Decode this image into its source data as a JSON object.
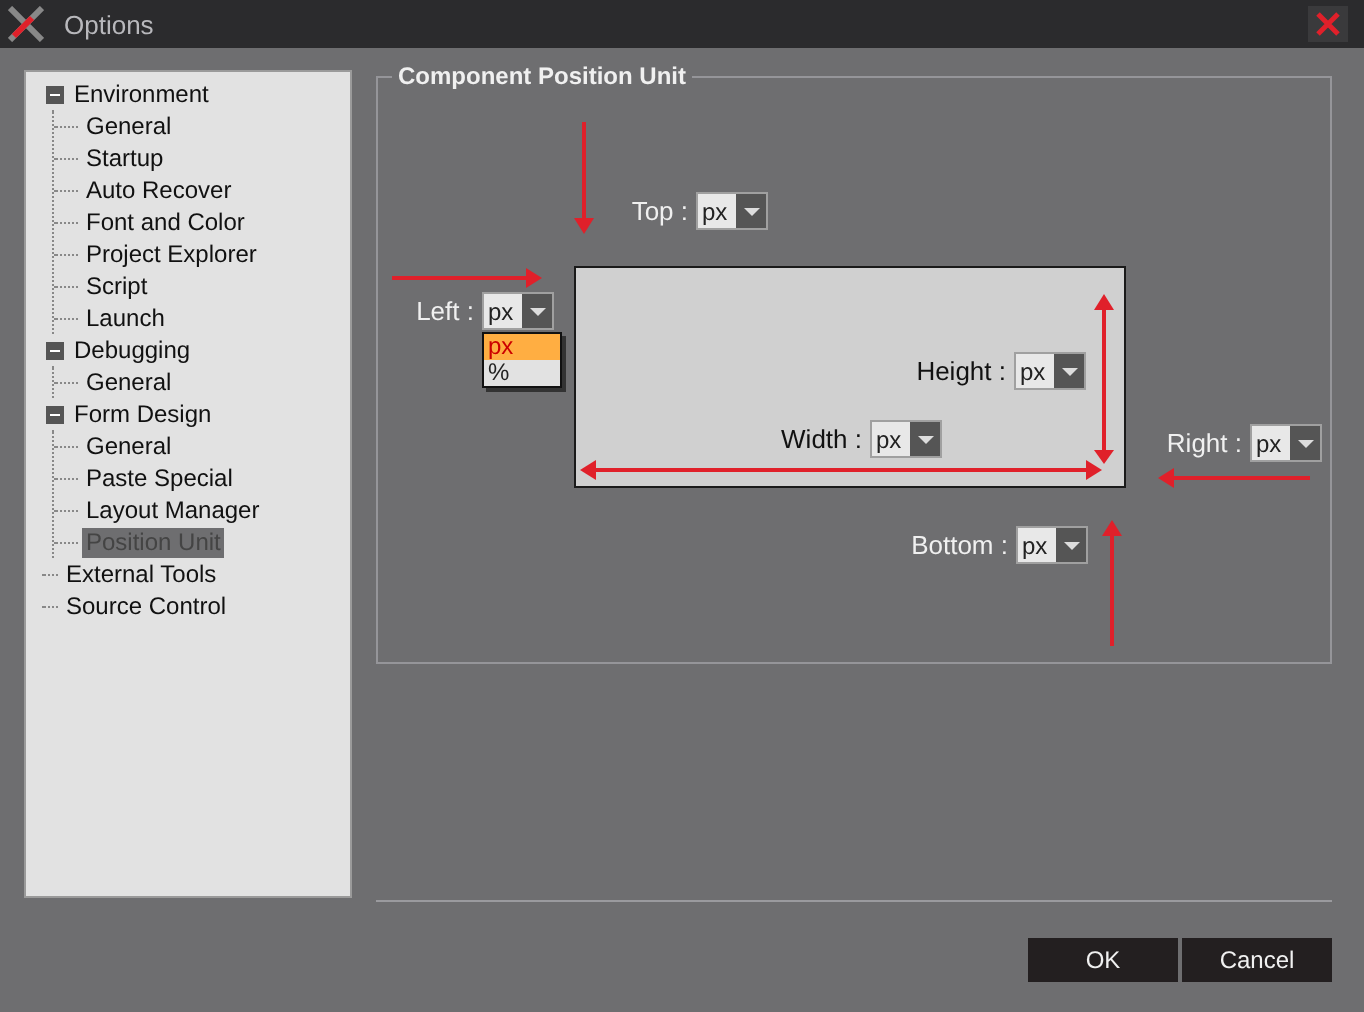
{
  "window": {
    "title": "Options"
  },
  "tree": [
    {
      "label": "Environment",
      "expanded": true,
      "selected": false,
      "children": [
        {
          "label": "General",
          "selected": false
        },
        {
          "label": "Startup",
          "selected": false
        },
        {
          "label": "Auto Recover",
          "selected": false
        },
        {
          "label": "Font and Color",
          "selected": false
        },
        {
          "label": "Project Explorer",
          "selected": false
        },
        {
          "label": "Script",
          "selected": false
        },
        {
          "label": "Launch",
          "selected": false
        }
      ]
    },
    {
      "label": "Debugging",
      "expanded": true,
      "selected": false,
      "children": [
        {
          "label": "General",
          "selected": false
        }
      ]
    },
    {
      "label": "Form Design",
      "expanded": true,
      "selected": false,
      "children": [
        {
          "label": "General",
          "selected": false
        },
        {
          "label": "Paste Special",
          "selected": false
        },
        {
          "label": "Layout Manager",
          "selected": false
        },
        {
          "label": "Position Unit",
          "selected": true
        }
      ]
    },
    {
      "label": "External Tools",
      "selected": false
    },
    {
      "label": "Source Control",
      "selected": false
    }
  ],
  "group": {
    "title": "Component Position Unit",
    "fields": [
      {
        "kind": "top",
        "label": "Top :",
        "value": "px"
      },
      {
        "kind": "left",
        "label": "Left :",
        "value": "px",
        "options": [
          {
            "label": "px",
            "selected": true
          },
          {
            "label": "%",
            "selected": false
          }
        ]
      },
      {
        "kind": "height",
        "label": "Height :",
        "value": "px"
      },
      {
        "kind": "width",
        "label": "Width :",
        "value": "px"
      },
      {
        "kind": "right",
        "label": "Right :",
        "value": "px"
      },
      {
        "kind": "bottom",
        "label": "Bottom :",
        "value": "px"
      }
    ]
  },
  "buttons": [
    "OK",
    "Cancel"
  ]
}
